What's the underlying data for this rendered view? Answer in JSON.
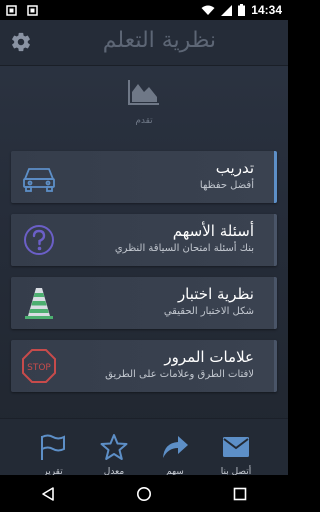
{
  "status_bar": {
    "time": "14:34",
    "icons": [
      "notification-icon",
      "notification-icon",
      "wifi-icon",
      "signal-icon",
      "battery-icon"
    ]
  },
  "header": {
    "title": "نظرية التعلم",
    "settings_icon": "gear-icon"
  },
  "progress": {
    "icon": "area-chart-icon",
    "label": "تقدم"
  },
  "cards": [
    {
      "title": "تدريب",
      "subtitle": "أفضل حفظها",
      "icon": "car-icon",
      "accent": "#5d8fc7"
    },
    {
      "title": "أسئلة الأسهم",
      "subtitle": "بنك أسئلة امتحان السياقة النظري",
      "icon": "question-icon",
      "accent": "#6b5fc7"
    },
    {
      "title": "نظرية اختبار",
      "subtitle": "شكل الاختبار الحقيقي",
      "icon": "cone-icon",
      "accent": "#4caf70"
    },
    {
      "title": "علامات المرور",
      "subtitle": "لافتات الطرق وعلامات على الطريق",
      "icon": "stop-sign-icon",
      "accent": "#c74b4b"
    }
  ],
  "bottom_nav": [
    {
      "label": "أتصل بنا",
      "icon": "mail-icon"
    },
    {
      "label": "سهم",
      "icon": "share-icon"
    },
    {
      "label": "معدل",
      "icon": "star-icon"
    },
    {
      "label": "تقرير",
      "icon": "flag-icon"
    }
  ],
  "colors": {
    "background": "#262d3a",
    "header": "#252c38",
    "card": "#373f4d",
    "card_accent": "#5d8fc7"
  }
}
